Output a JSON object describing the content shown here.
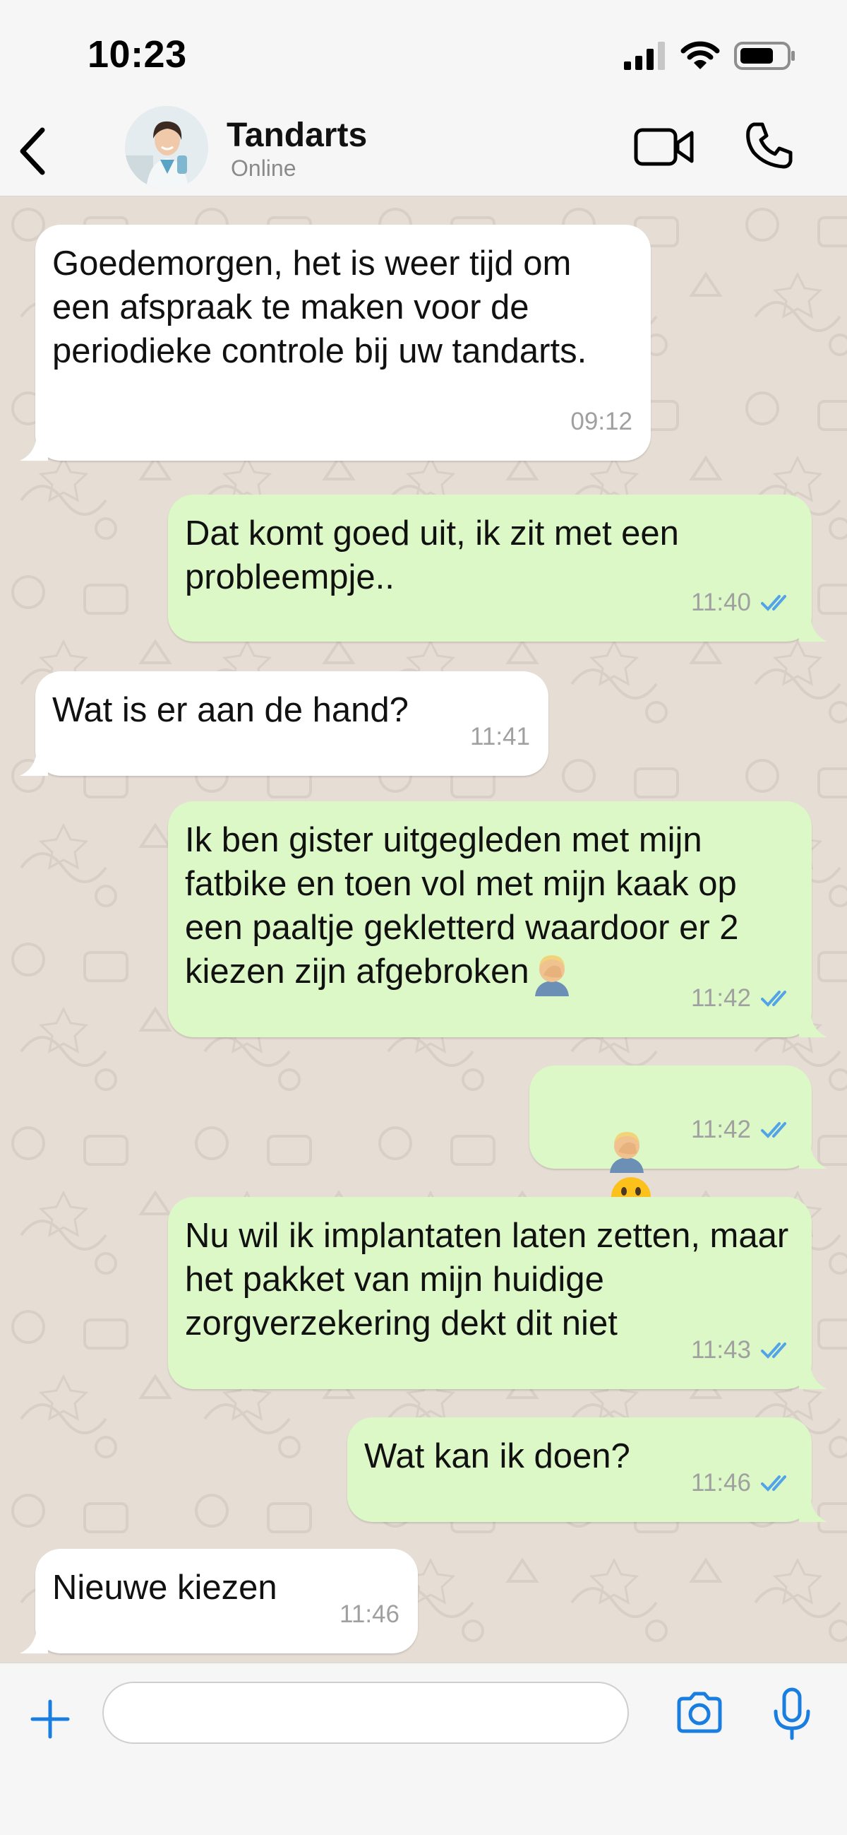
{
  "status_bar": {
    "time": "10:23",
    "icons": [
      "signal-icon",
      "wifi-icon",
      "battery-icon"
    ]
  },
  "header": {
    "contact_name": "Tandarts",
    "contact_status": "Online",
    "icons": [
      "back-chevron-icon",
      "video-call-icon",
      "phone-icon"
    ]
  },
  "colors": {
    "incoming_bubble": "#ffffff",
    "outgoing_bubble": "#dcf8c6",
    "read_ticks": "#53a3e8",
    "accent_blue": "#1a7de0",
    "chat_background": "#e6ddd4"
  },
  "messages": [
    {
      "direction": "in",
      "text": "Goedemorgen, het is weer tijd om een afspraak te maken voor de periodieke controle bij uw tandarts.",
      "time": "09:12"
    },
    {
      "direction": "out",
      "text": "Dat komt goed uit, ik zit met een probleempje..",
      "time": "11:40",
      "read": true
    },
    {
      "direction": "in",
      "text": "Wat is er aan de hand?",
      "time": "11:41"
    },
    {
      "direction": "out",
      "text": "Ik ben gister uitgegleden met mijn fatbike en toen vol met mijn kaak op een paaltje gekletterd waardoor er 2 kiezen zijn afgebroken",
      "emoji": [
        "facepalm-emoji"
      ],
      "time": "11:42",
      "read": true
    },
    {
      "direction": "out",
      "text": "",
      "emoji": [
        "facepalm-emoji",
        "grimacing-face-emoji"
      ],
      "time": "11:42",
      "read": true
    },
    {
      "direction": "out",
      "text": "Nu wil ik implantaten laten zetten, maar het pakket van mijn huidige zorgverzekering dekt dit niet",
      "time": "11:43",
      "read": true
    },
    {
      "direction": "out",
      "text": "Wat kan ik doen?",
      "time": "11:46",
      "read": true
    },
    {
      "direction": "in",
      "text": "Nieuwe kiezen",
      "time": "11:46"
    }
  ],
  "input_bar": {
    "message_value": "",
    "placeholder": "",
    "icons": [
      "plus-icon",
      "camera-icon",
      "microphone-icon"
    ]
  }
}
